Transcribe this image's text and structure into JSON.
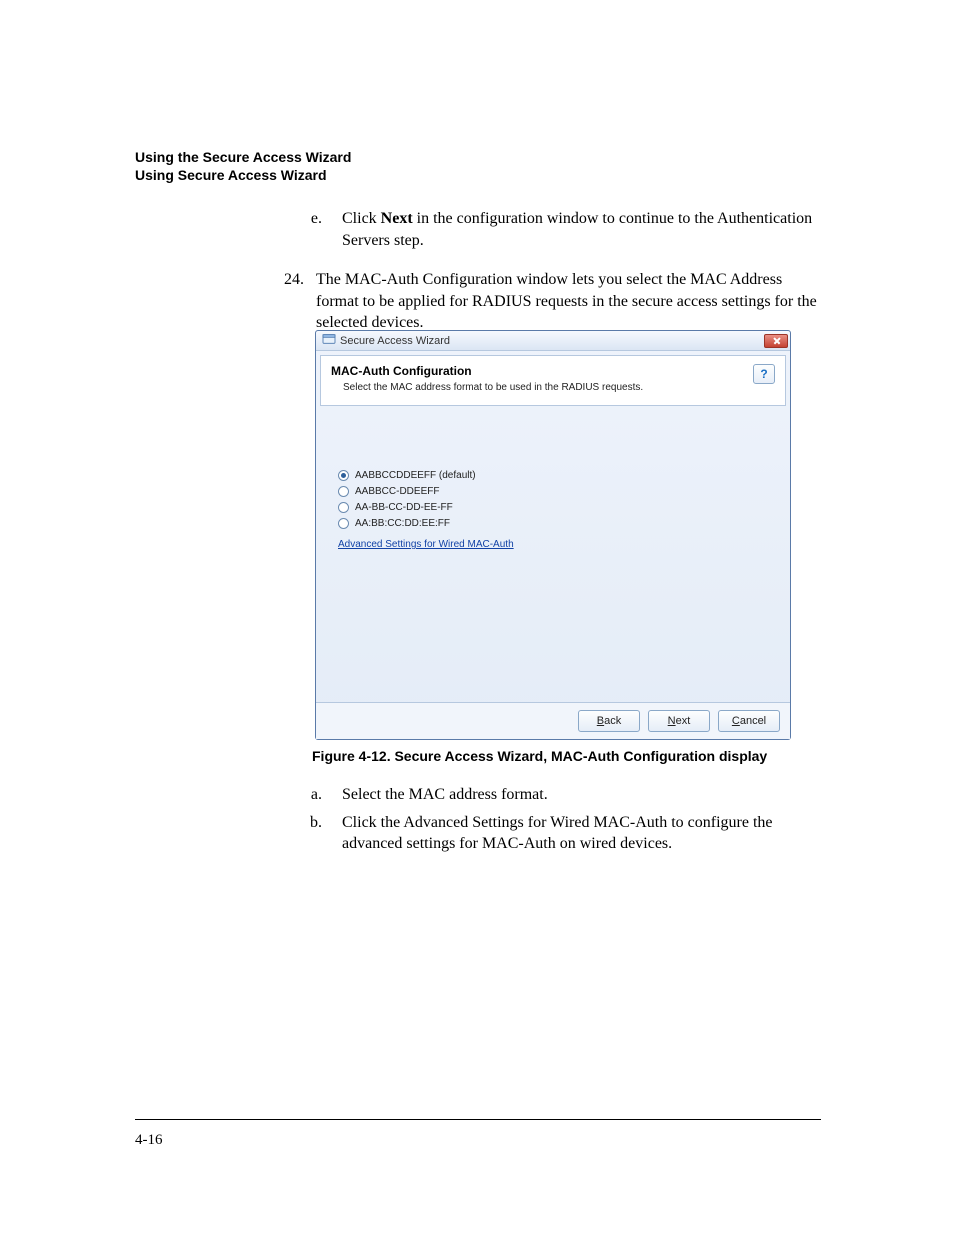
{
  "header": {
    "line1": "Using the Secure Access Wizard",
    "line2": "Using Secure Access Wizard"
  },
  "steps": {
    "e_marker": "e.",
    "e_prefix": "Click ",
    "e_bold": "Next",
    "e_suffix": " in the configuration window to continue to the Authentication Servers step.",
    "n24_marker": "24.",
    "n24_text": "The MAC-Auth Configuration window lets you select the MAC Address format to be applied for RADIUS requests in the secure access settings for the selected devices.",
    "a_marker": "a.",
    "a_text": "Select the MAC address format.",
    "b_marker": "b.",
    "b_text": "Click the Advanced Settings for Wired MAC-Auth to configure the advanced settings for MAC-Auth on wired devices."
  },
  "dialog": {
    "title": "Secure Access Wizard",
    "panel_title": "MAC-Auth Configuration",
    "panel_sub": "Select the MAC address format to be used in the RADIUS requests.",
    "help_glyph": "?",
    "options": [
      {
        "label": "AABBCCDDEEFF (default)",
        "selected": true
      },
      {
        "label": "AABBCC-DDEEFF",
        "selected": false
      },
      {
        "label": "AA-BB-CC-DD-EE-FF",
        "selected": false
      },
      {
        "label": "AA:BB:CC:DD:EE:FF",
        "selected": false
      }
    ],
    "advanced_link": "Advanced Settings for Wired MAC-Auth",
    "buttons": {
      "back": {
        "u": "B",
        "rest": "ack"
      },
      "next": {
        "u": "N",
        "rest": "ext"
      },
      "cancel": {
        "u": "C",
        "rest": "ancel"
      }
    }
  },
  "caption": "Figure 4-12. Secure Access Wizard, MAC-Auth Configuration display",
  "page_number": "4-16"
}
